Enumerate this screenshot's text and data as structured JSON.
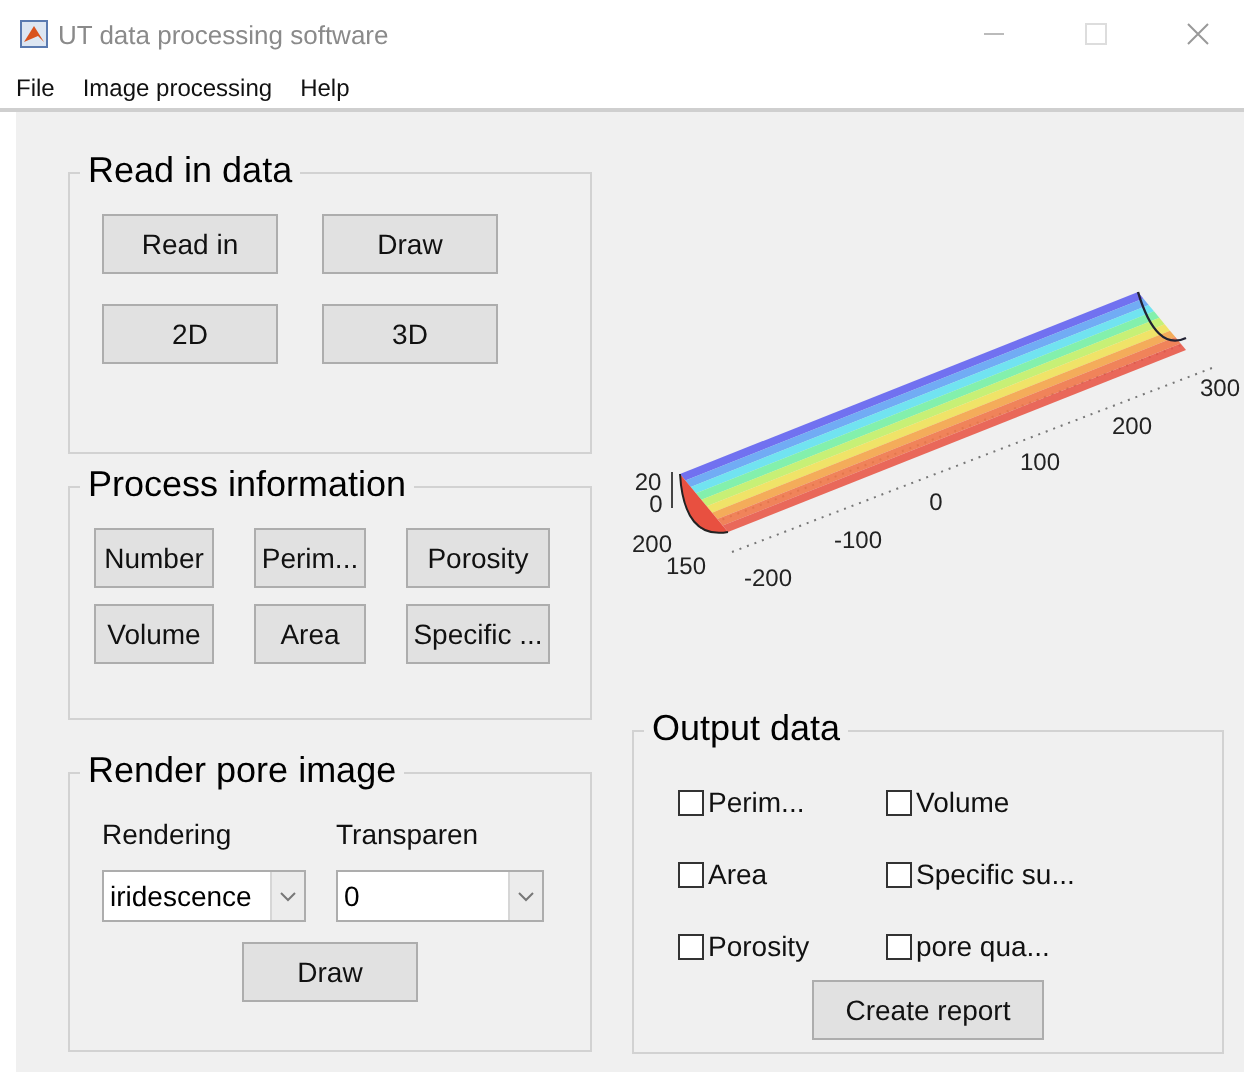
{
  "window": {
    "title": "UT data processing software"
  },
  "menu": [
    "File",
    "Image processing",
    "Help"
  ],
  "read_panel": {
    "title": "Read in data",
    "buttons": [
      "Read in",
      "Draw",
      "2D",
      "3D"
    ]
  },
  "process_panel": {
    "title": "Process information",
    "buttons": [
      "Number",
      "Perim...",
      "Porosity",
      "Volume",
      "Area",
      "Specific ..."
    ]
  },
  "render_panel": {
    "title": "Render pore image",
    "fields": [
      {
        "label": "Rendering",
        "value": "iridescence"
      },
      {
        "label": "Transparen",
        "value": "0"
      }
    ],
    "button": "Draw"
  },
  "plot": {
    "x_ticks": [
      "-200",
      "-100",
      "0",
      "100",
      "200",
      "300"
    ],
    "z_ticks": [
      "20",
      "0"
    ],
    "y_ticks": [
      "200",
      "150"
    ]
  },
  "output_panel": {
    "title": "Output data",
    "checkboxes": [
      {
        "label": "Perim...",
        "checked": false
      },
      {
        "label": "Volume",
        "checked": false
      },
      {
        "label": "Area",
        "checked": false
      },
      {
        "label": "Specific su...",
        "checked": false
      },
      {
        "label": "Porosity",
        "checked": false
      },
      {
        "label": "pore qua...",
        "checked": false
      }
    ],
    "button": "Create report"
  }
}
